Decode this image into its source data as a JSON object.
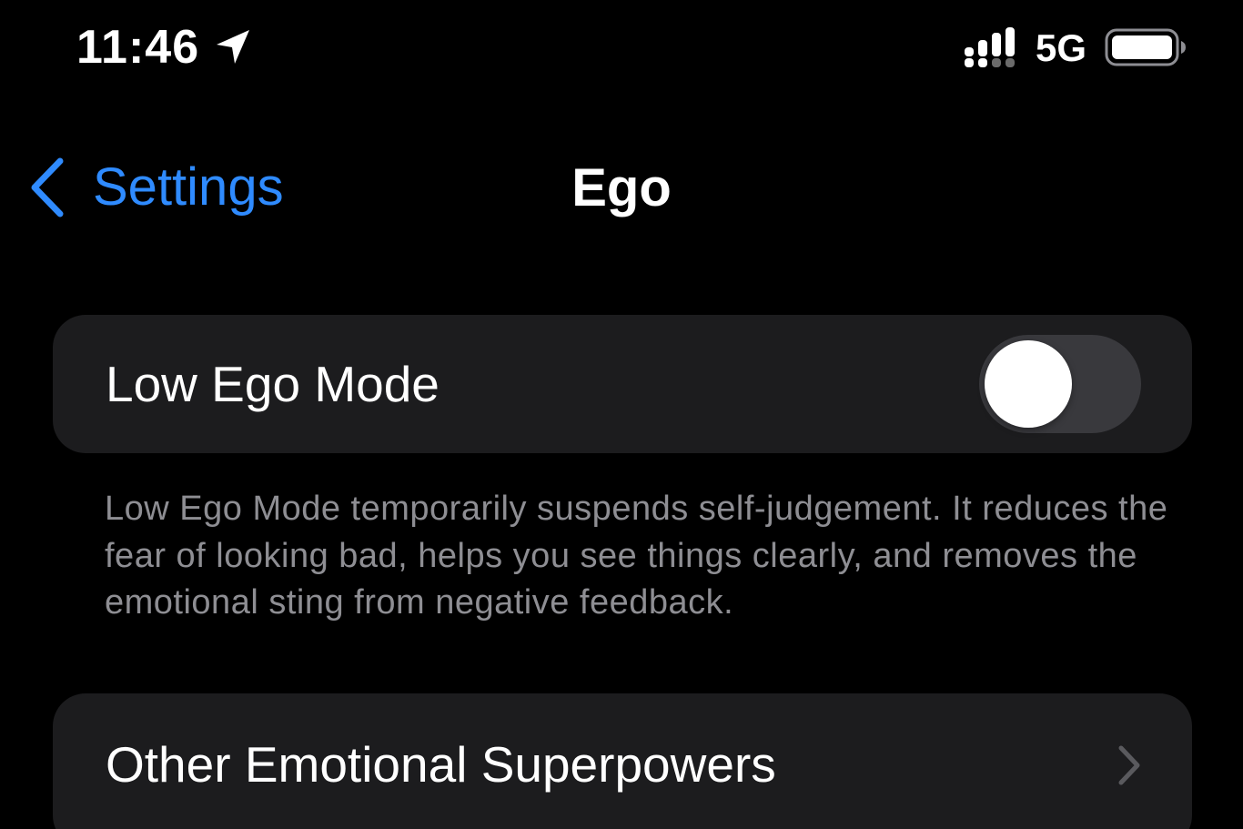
{
  "status_bar": {
    "time": "11:46",
    "network": "5G",
    "icons": [
      "location-arrow-icon",
      "cellular-signal-icon",
      "battery-icon"
    ]
  },
  "nav": {
    "back_label": "Settings",
    "title": "Ego"
  },
  "settings": {
    "low_ego_mode": {
      "label": "Low Ego Mode",
      "enabled": false,
      "description": "Low Ego Mode temporarily suspends self-judgement. It reduces the fear of looking bad, helps you see things clearly, and removes the emotional sting from negative feedback."
    },
    "other_superpowers": {
      "label": "Other Emotional Superpowers"
    }
  },
  "colors": {
    "background": "#000000",
    "card": "#1c1c1e",
    "accent": "#2f8bff",
    "secondary_text": "#8e8e93",
    "toggle_off": "#39393d"
  }
}
